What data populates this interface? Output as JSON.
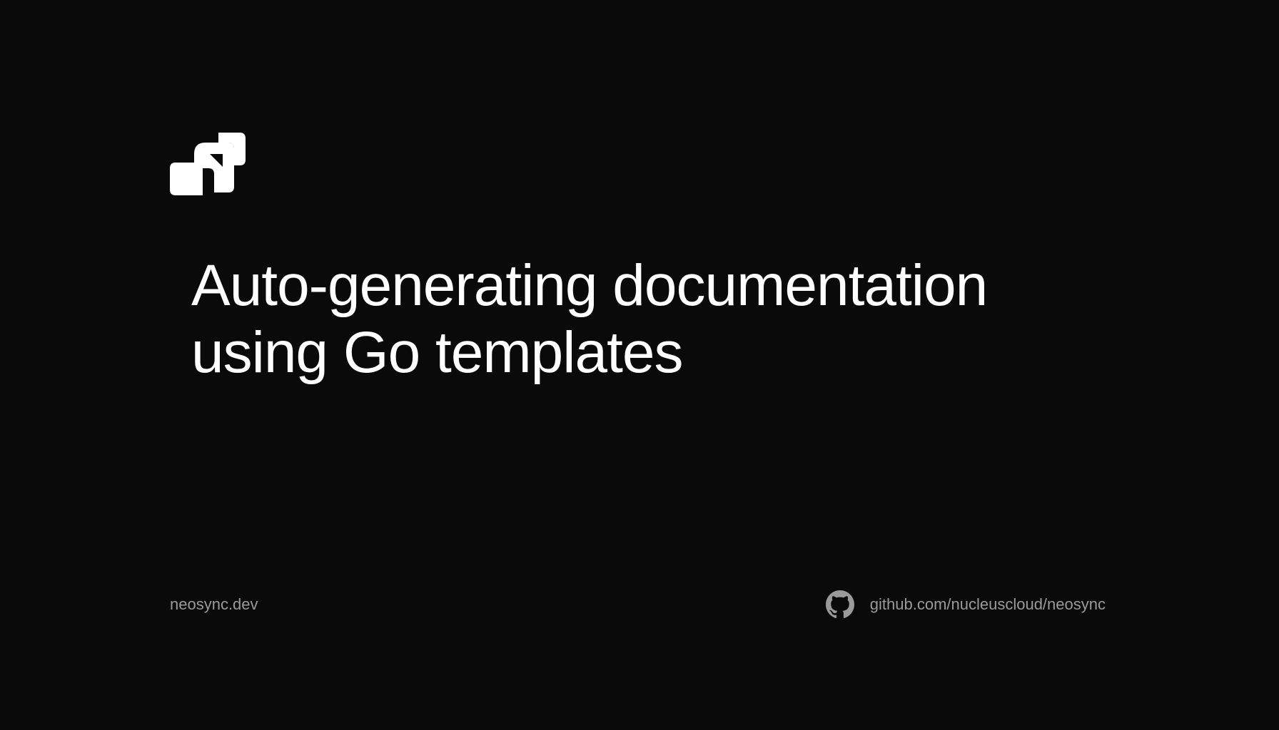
{
  "title": "Auto-generating documentation using Go templates",
  "footer": {
    "website": "neosync.dev",
    "github_link": "github.com/nucleuscloud/neosync"
  }
}
